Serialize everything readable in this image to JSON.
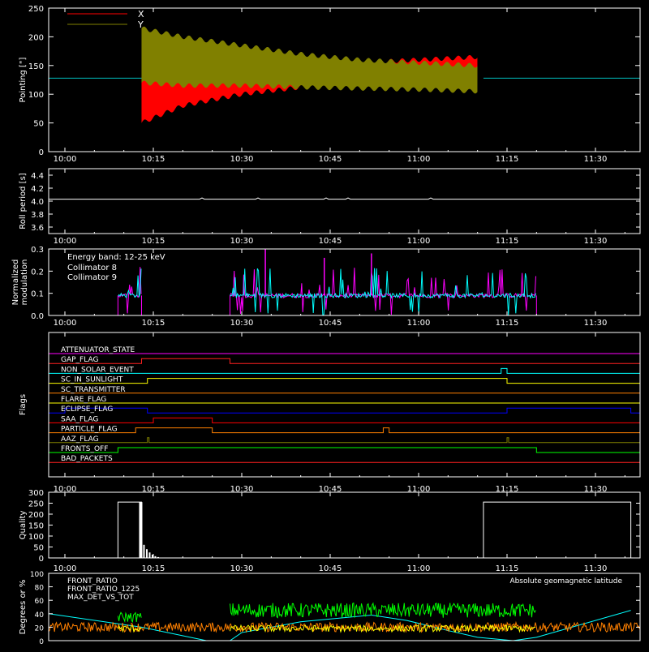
{
  "chart_data": [
    {
      "id": "pointing",
      "type": "line",
      "ylabel": "Pointing [\"]",
      "ylim": [
        0,
        250
      ],
      "yticks": [
        0,
        50,
        100,
        150,
        200,
        250
      ],
      "xticks": [
        "10:00",
        "10:15",
        "10:30",
        "10:45",
        "11:00",
        "11:15",
        "11:30"
      ],
      "legend_position": "top-left",
      "series": [
        {
          "name": "X",
          "color": "#ff0000",
          "envelope": {
            "x": [
              "10:13",
              "10:20",
              "10:30",
              "10:40",
              "10:50",
              "11:00",
              "11:10"
            ],
            "low": [
              50,
              80,
              100,
              112,
              120,
              125,
              128
            ],
            "high": [
              130,
              135,
              140,
              148,
              155,
              160,
              165
            ]
          }
        },
        {
          "name": "Y",
          "color": "#808000",
          "envelope": {
            "x": [
              "10:13",
              "10:20",
              "10:30",
              "10:40",
              "10:50",
              "11:00",
              "11:10"
            ],
            "low": [
              120,
              115,
              115,
              112,
              110,
              108,
              105
            ],
            "high": [
              215,
              200,
              185,
              170,
              160,
              155,
              150
            ]
          }
        }
      ],
      "reference_line": 128,
      "data_range": [
        "10:13",
        "11:11"
      ]
    },
    {
      "id": "roll",
      "type": "line",
      "ylabel": "Roll period [s]",
      "ylim": [
        3.5,
        4.5
      ],
      "yticks": [
        "3.6",
        "3.8",
        "4.0",
        "4.2",
        "4.4"
      ],
      "xticks": [
        "10:00",
        "10:15",
        "10:30",
        "10:45",
        "11:00",
        "11:15",
        "11:30"
      ],
      "series": [
        {
          "color": "#ffffff",
          "value": 4.03
        }
      ]
    },
    {
      "id": "modulation",
      "type": "line",
      "ylabel": "Normalized\nmodulation",
      "ylim": [
        0,
        0.3
      ],
      "yticks": [
        "0.0",
        "0.1",
        "0.2",
        "0.3"
      ],
      "xticks": [
        "10:00",
        "10:15",
        "10:30",
        "10:45",
        "11:00",
        "11:15",
        "11:30"
      ],
      "annotations": [
        "Energy band: 12-25 keV"
      ],
      "series": [
        {
          "name": "Collimator 8",
          "color": "#00ffff"
        },
        {
          "name": "Collimator 9",
          "color": "#ff00ff"
        }
      ],
      "active_intervals": [
        [
          "10:09",
          "10:13"
        ],
        [
          "10:28",
          "11:20"
        ]
      ]
    },
    {
      "id": "flags",
      "type": "line",
      "ylabel": "Flags",
      "xticks": [
        "10:00",
        "10:15",
        "10:30",
        "10:45",
        "11:00",
        "11:15",
        "11:30"
      ],
      "flags": [
        {
          "name": "ATTENUATOR_STATE",
          "color": "#ff00ff",
          "on": []
        },
        {
          "name": "GAP_FLAG",
          "color": "#ff2020",
          "on": [
            [
              "10:13",
              "10:28"
            ]
          ]
        },
        {
          "name": "NON_SOLAR_EVENT",
          "color": "#00ffff",
          "on": [
            [
              "11:14",
              "11:15"
            ]
          ]
        },
        {
          "name": "SC_IN_SUNLIGHT",
          "color": "#ffff00",
          "on": [
            [
              "10:14",
              "11:15"
            ]
          ]
        },
        {
          "name": "SC_TRANSMITTER",
          "color": "#ff8000",
          "on": []
        },
        {
          "name": "FLARE_FLAG",
          "color": "#ffff00",
          "on": []
        },
        {
          "name": "ECLIPSE_FLAG",
          "color": "#0000ff",
          "on": [
            [
              "10:00",
              "10:14"
            ],
            [
              "11:15",
              "11:36"
            ]
          ]
        },
        {
          "name": "SAA_FLAG",
          "color": "#ff0000",
          "on": [
            [
              "10:15",
              "10:25"
            ]
          ]
        },
        {
          "name": "PARTICLE_FLAG",
          "color": "#ff8000",
          "on": [
            [
              "10:12",
              "10:25"
            ],
            [
              "10:54",
              "10:55"
            ]
          ]
        },
        {
          "name": "AAZ_FLAG",
          "color": "#808000",
          "on": [
            [
              "10:14",
              "10:14"
            ],
            [
              "11:15",
              "11:15"
            ]
          ]
        },
        {
          "name": "FRONTS_OFF",
          "color": "#00ff00",
          "on": [
            [
              "10:09",
              "11:20"
            ]
          ]
        },
        {
          "name": "BAD_PACKETS",
          "color": "#ff2020",
          "on": []
        }
      ]
    },
    {
      "id": "quality",
      "type": "bar",
      "ylabel": "Quality",
      "ylim": [
        0,
        300
      ],
      "yticks": [
        0,
        50,
        100,
        150,
        200,
        250,
        300
      ],
      "xticks": [
        "10:00",
        "10:15",
        "10:30",
        "10:45",
        "11:00",
        "11:15",
        "11:30"
      ],
      "series": [
        {
          "color": "#ffffff",
          "blocks": [
            {
              "x": [
                "10:09",
                "10:13"
              ],
              "value": 255
            },
            {
              "x": [
                "11:11",
                "11:36"
              ],
              "value": 255
            }
          ]
        }
      ]
    },
    {
      "id": "front_ratio",
      "type": "line",
      "ylabel": "Degrees or %",
      "ylim": [
        0,
        100
      ],
      "yticks": [
        0,
        20,
        40,
        60,
        80,
        100
      ],
      "series": [
        {
          "name": "FRONT_RATIO",
          "color": "#ffff00"
        },
        {
          "name": "FRONT_RATIO_1225",
          "color": "#00ff00"
        },
        {
          "name": "MAX_DET_VS_TOT",
          "color": "#ff8000"
        },
        {
          "name": "Absolute geomagnetic latitude",
          "color": "#00ffff"
        }
      ]
    }
  ]
}
